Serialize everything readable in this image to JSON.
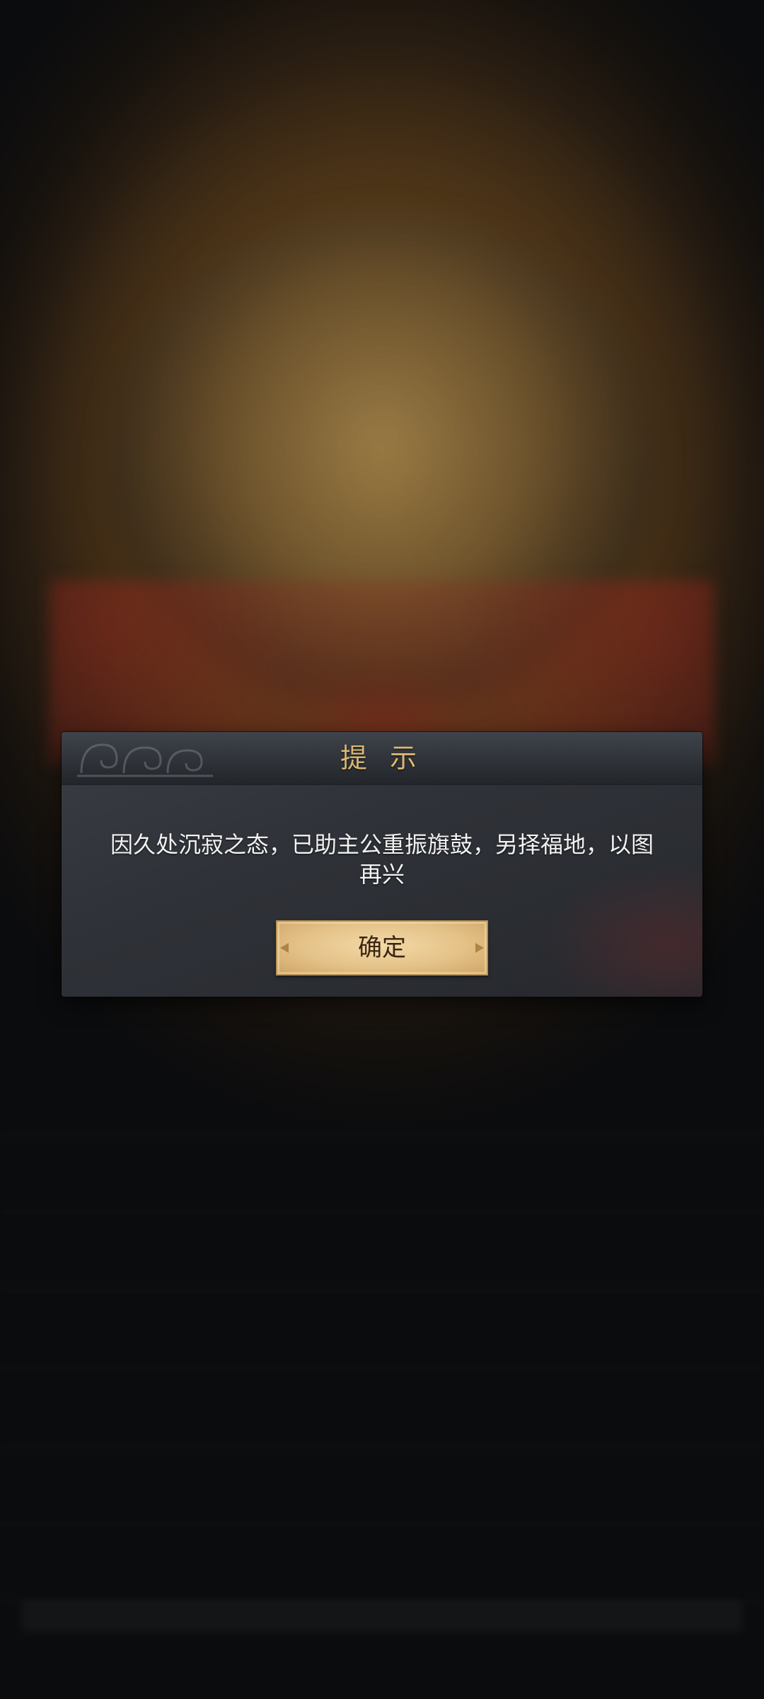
{
  "dialog": {
    "title": "提 示",
    "message": "因久处沉寂之态，已助主公重振旗鼓，另择福地，以图再兴",
    "confirm_label": "确定"
  },
  "colors": {
    "title_gold": "#d9b872",
    "button_fill": "#e4c288",
    "button_border": "#b8914e",
    "panel_bg": "#2f3238"
  },
  "icons": {
    "header_ornament": "cloud-scroll-ornament"
  }
}
